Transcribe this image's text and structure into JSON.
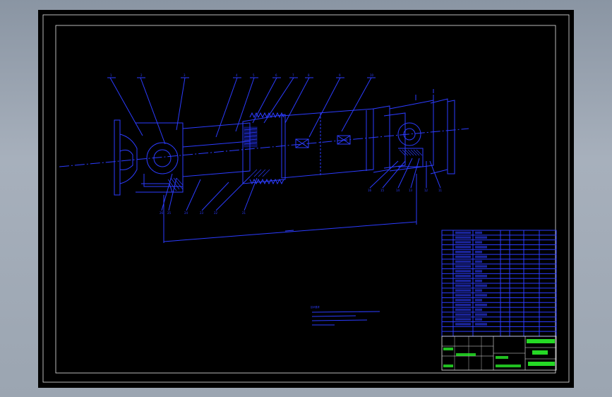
{
  "window": {
    "accent": "#2c3cff",
    "background": "#000000",
    "highlight": "#2bff2b"
  },
  "balloons_top": [
    "1",
    "2",
    "3",
    "4",
    "5",
    "6",
    "7",
    "8",
    "9",
    "10"
  ],
  "balloons_bottom_left": [
    "26",
    "25",
    "24",
    "23",
    "22",
    "21"
  ],
  "balloons_bottom_right": [
    "16",
    "15",
    "14",
    "13",
    "12",
    "11"
  ],
  "notes_title": "技术要求",
  "parts_rows": 22,
  "icons": [
    "part-marker-icon"
  ]
}
